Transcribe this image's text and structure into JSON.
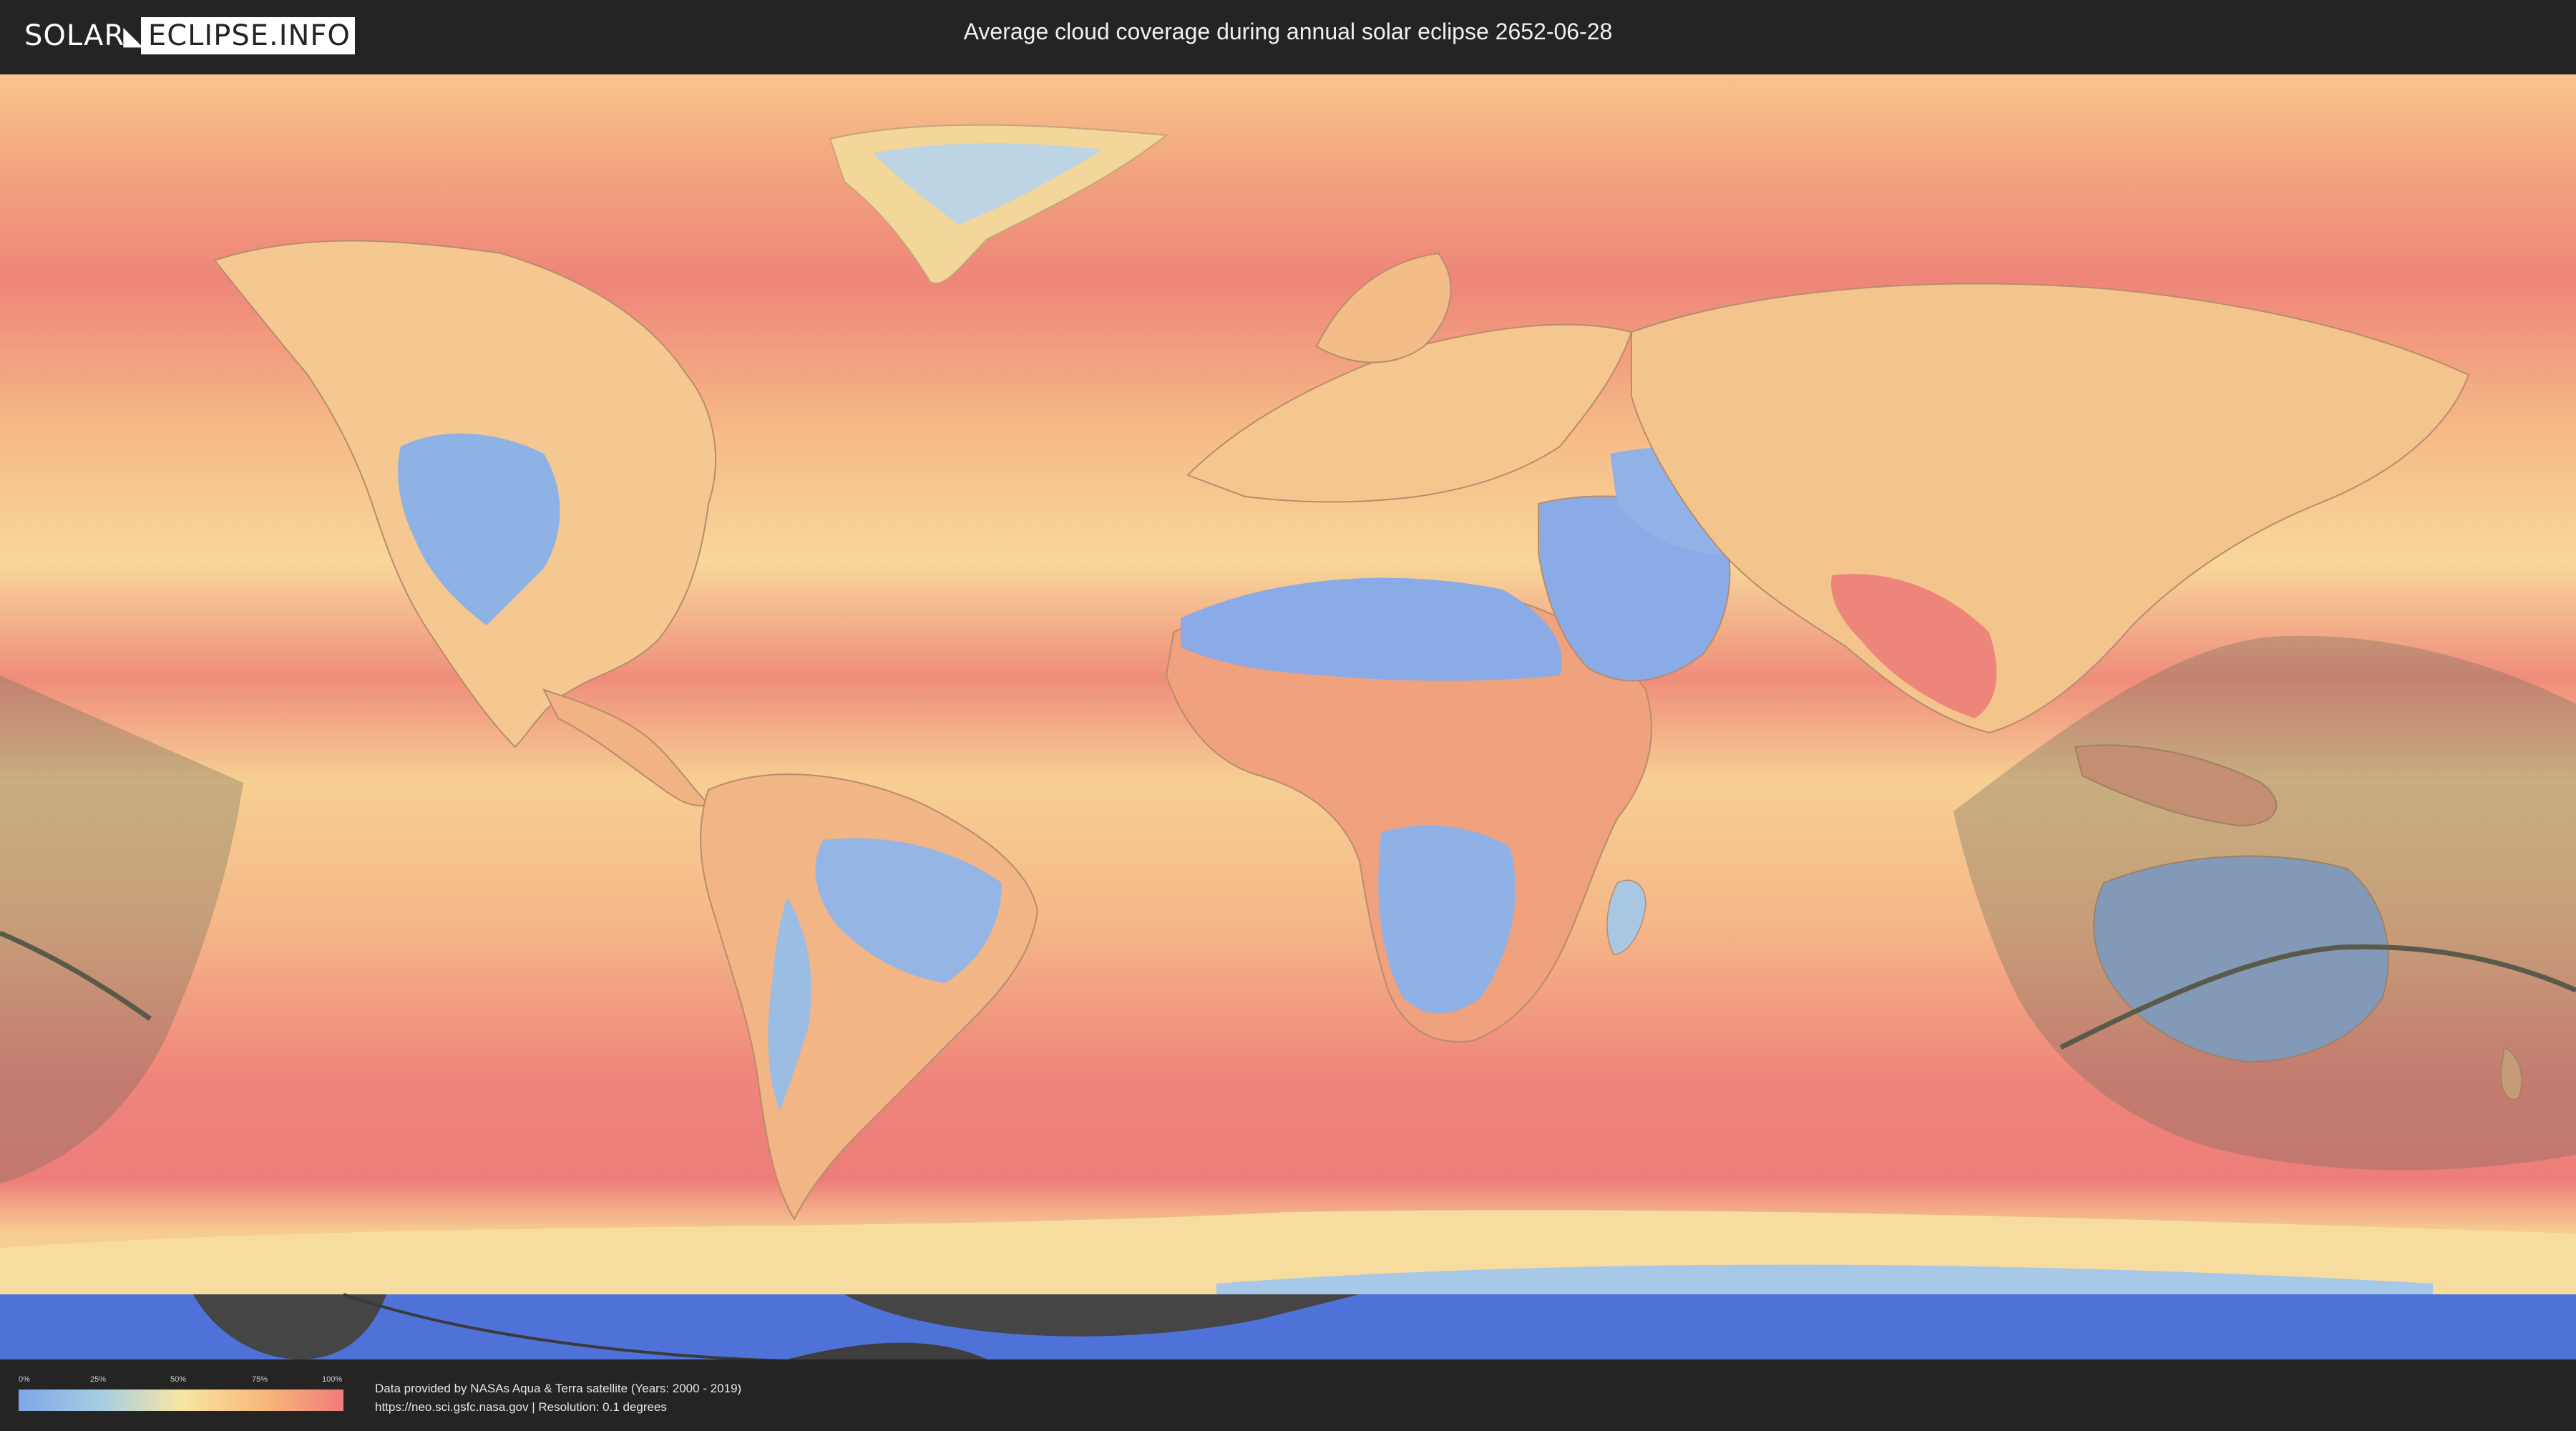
{
  "header": {
    "logo_left": "SOLAR",
    "logo_right": "ECLIPSE.INFO",
    "title": "Average cloud coverage during annual solar eclipse 2652-06-28"
  },
  "legend": {
    "ticks": [
      "0%",
      "25%",
      "50%",
      "75%",
      "100%"
    ],
    "colors": [
      "#7fa6e8",
      "#a6cde3",
      "#f7e6a3",
      "#f8b97a",
      "#ef7c7c"
    ]
  },
  "credits": {
    "line1": "Data provided by NASAs Aqua & Terra satellite (Years: 2000 - 2019)",
    "line2": "https://neo.sci.gsfc.nasa.gov | Resolution: 0.1 degrees"
  },
  "map": {
    "colors": {
      "ocean_high": "#ef8a7c",
      "ocean_mid": "#f6c48c",
      "clear_land": "#8fb0e6",
      "antarctica": "#4f72d8",
      "shadow": "#6b6b5a",
      "path_line": "#5a5a4a"
    }
  }
}
